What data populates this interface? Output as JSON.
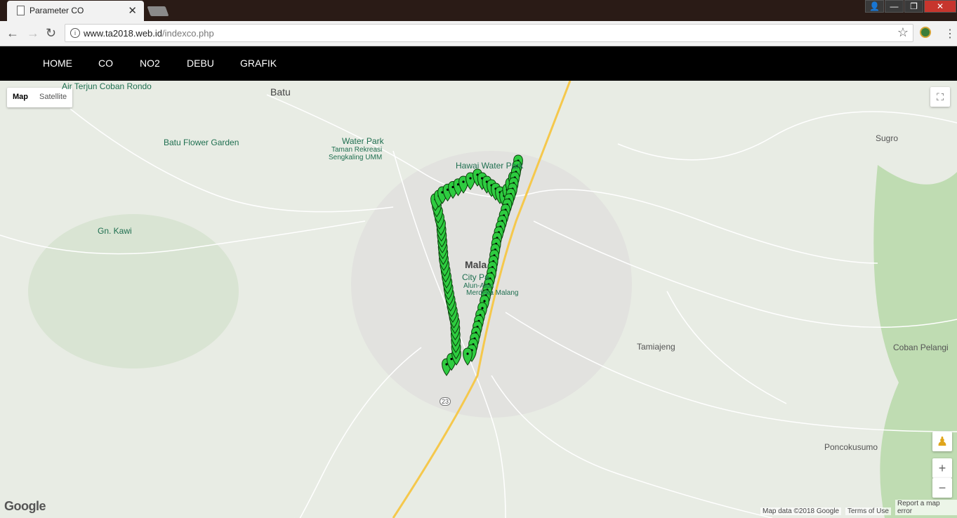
{
  "browser": {
    "tab_title": "Parameter CO",
    "close_glyph": "✕",
    "url_host": "www.ta2018.web.id",
    "url_path": "/indexco.php"
  },
  "nav": {
    "items": [
      "HOME",
      "CO",
      "NO2",
      "DEBU",
      "GRAFIK"
    ]
  },
  "map": {
    "type_buttons": [
      "Map",
      "Satellite"
    ],
    "labels": {
      "batu": "Batu",
      "coban_rondo": "Air Terjun Coban Rondo",
      "flower_garden": "Batu Flower Garden",
      "water_park": "Water Park",
      "taman_rekreasi": "Taman Rekreasi",
      "sengkaling": "Sengkaling UMM",
      "hawai": "Hawai Water Park",
      "sugro": "Sugro",
      "kawi": "Gn. Kawi",
      "malang": "Mala",
      "city_park": "City Pa",
      "alun": "Alun-Alun",
      "merdeka": "Merdeka Malang",
      "tamiajeng": "Tamiajeng",
      "coban_pelangi": "Coban Pelangi",
      "poncokusumo": "Poncokusumo",
      "route23": "23"
    },
    "attribution": {
      "data": "Map data ©2018 Google",
      "terms": "Terms of Use",
      "report": "Report a map error"
    },
    "logo": "Google",
    "marker_color": "#2ecc40"
  }
}
